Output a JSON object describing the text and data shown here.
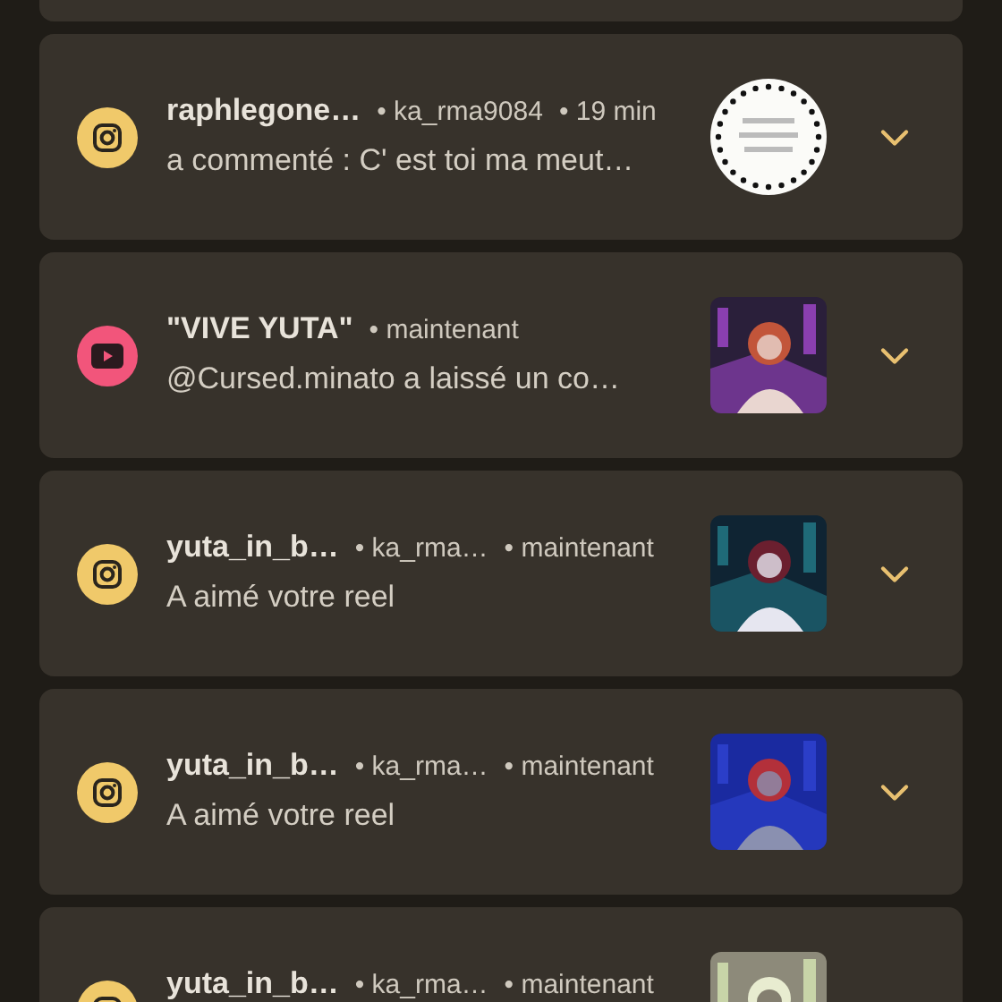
{
  "notifications": [
    {
      "kind": "camera",
      "color": "#f0c96a",
      "title": "raphlegone…",
      "meta": [
        "• ka_rma9084",
        "• 19 min"
      ],
      "body": "a commenté : C' est toi ma meut…",
      "thumbnail": {
        "kind": "picture"
      }
    },
    {
      "kind": "play",
      "color": "#f2557b",
      "title": "\"VIVE YUTA\"",
      "meta": [
        "• maintenant"
      ],
      "body": "@Cursed.minato a laissé un co…",
      "thumbnail": {
        "kind": "picture"
      }
    },
    {
      "kind": "camera",
      "color": "#f0c96a",
      "title": "yuta_in_b…",
      "meta": [
        "• ka_rma…",
        "• maintenant"
      ],
      "body": "A aimé votre reel",
      "thumbnail": {
        "kind": "picture"
      }
    },
    {
      "kind": "camera",
      "color": "#f0c96a",
      "title": "yuta_in_b…",
      "meta": [
        "• ka_rma…",
        "• maintenant"
      ],
      "body": "A aimé votre reel",
      "thumbnail": {
        "kind": "picture"
      }
    },
    {
      "kind": "camera",
      "color": "#f0c96a",
      "title": "yuta_in_b…",
      "meta": [
        "• ka_rma…",
        "• maintenant"
      ],
      "thumbnail": {
        "kind": "picture"
      }
    }
  ]
}
